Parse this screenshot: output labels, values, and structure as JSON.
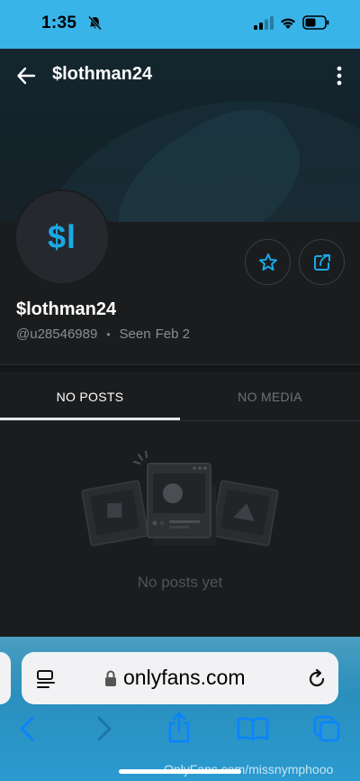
{
  "status_bar": {
    "time": "1:35"
  },
  "header": {
    "title": "$lothman24"
  },
  "profile": {
    "avatar_initials": "$l",
    "display_name": "$lothman24",
    "handle": "@u28546989",
    "separator": "•",
    "seen_label": "Seen",
    "seen_date": "Feb 2"
  },
  "tabs": [
    {
      "label": "NO POSTS",
      "active": true
    },
    {
      "label": "NO MEDIA",
      "active": false
    }
  ],
  "empty_state": {
    "message": "No posts yet"
  },
  "browser": {
    "url": "onlyfans.com"
  },
  "watermark": "OnlyFans.com/missnymphooo",
  "colors": {
    "accent": "#1aa9e6",
    "status_bar_bg": "#39b4e8",
    "page_bg": "#1b1c1e",
    "muted_text": "#8a8d91",
    "ios_blue": "#0a84ff"
  }
}
